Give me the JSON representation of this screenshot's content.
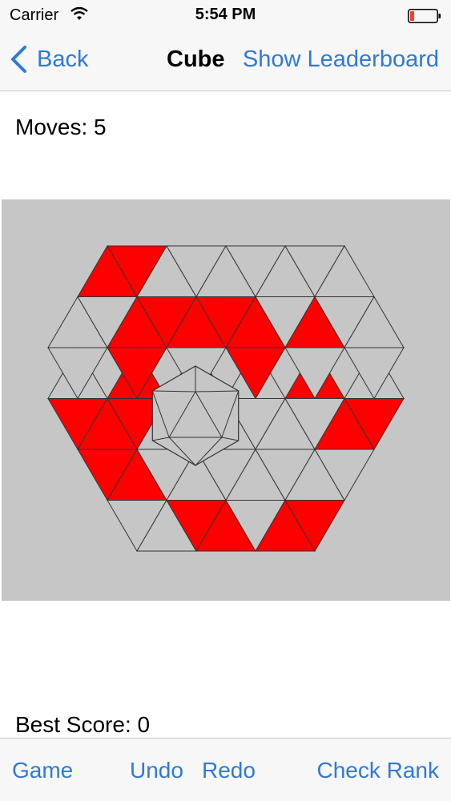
{
  "status_bar": {
    "carrier": "Carrier",
    "time": "5:54 PM",
    "battery_color": "#ff3b30"
  },
  "nav": {
    "back_label": "Back",
    "title": "Cube",
    "leaderboard_label": "Show Leaderboard"
  },
  "game": {
    "moves_text": "Moves: 5",
    "best_score_text": "Best Score: 0",
    "colors": {
      "red": "#ff0000",
      "gray": "#c6c6c6",
      "line": "#333333"
    },
    "red_tiles": [
      [
        0,
        0
      ],
      [
        0,
        1
      ],
      [
        1,
        2
      ],
      [
        1,
        3
      ],
      [
        1,
        4
      ],
      [
        1,
        5
      ],
      [
        1,
        6
      ],
      [
        1,
        8
      ],
      [
        2,
        2
      ],
      [
        2,
        3
      ],
      [
        2,
        4
      ],
      [
        2,
        7
      ],
      [
        2,
        8
      ],
      [
        3,
        0
      ],
      [
        3,
        1
      ],
      [
        3,
        2
      ],
      [
        3,
        9
      ],
      [
        3,
        10
      ],
      [
        3,
        11
      ],
      [
        3,
        12
      ],
      [
        3,
        13
      ],
      [
        4,
        0
      ],
      [
        4,
        1
      ],
      [
        5,
        2
      ],
      [
        5,
        3
      ],
      [
        5,
        5
      ],
      [
        5,
        6
      ]
    ]
  },
  "toolbar": {
    "game_label": "Game",
    "undo_label": "Undo",
    "redo_label": "Redo",
    "check_rank_label": "Check Rank"
  }
}
